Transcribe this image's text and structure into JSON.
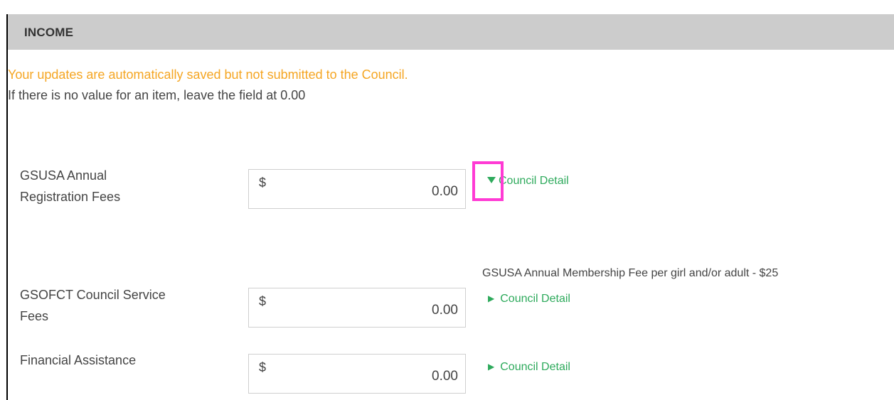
{
  "section": {
    "title": "INCOME"
  },
  "notices": {
    "autosave": "Your updates are automatically saved but not submitted to the Council.",
    "instruction": "If there is no value for an item, leave the field at 0.00"
  },
  "rows": [
    {
      "label_line1": "GSUSA Annual",
      "label_line2": "Registration Fees",
      "currency": "$",
      "value": "0.00",
      "detail_label": "Council Detail",
      "detail_expanded": true,
      "detail_text": "GSUSA Annual Membership Fee per girl and/or adult - $25"
    },
    {
      "label_line1": "GSOFCT Council Service",
      "label_line2": "Fees",
      "currency": "$",
      "value": "0.00",
      "detail_label": "Council Detail",
      "detail_expanded": false
    },
    {
      "label_line1": "Financial Assistance",
      "label_line2": "",
      "currency": "$",
      "value": "0.00",
      "detail_label": "Council Detail",
      "detail_expanded": false
    }
  ],
  "colors": {
    "header_bg": "#cccccc",
    "notice_orange": "#f5a623",
    "link_green": "#2eaa5c",
    "highlight_magenta": "#ff3ad4"
  },
  "icons": {
    "expanded": "triangle-down-icon",
    "collapsed": "triangle-right-icon"
  }
}
